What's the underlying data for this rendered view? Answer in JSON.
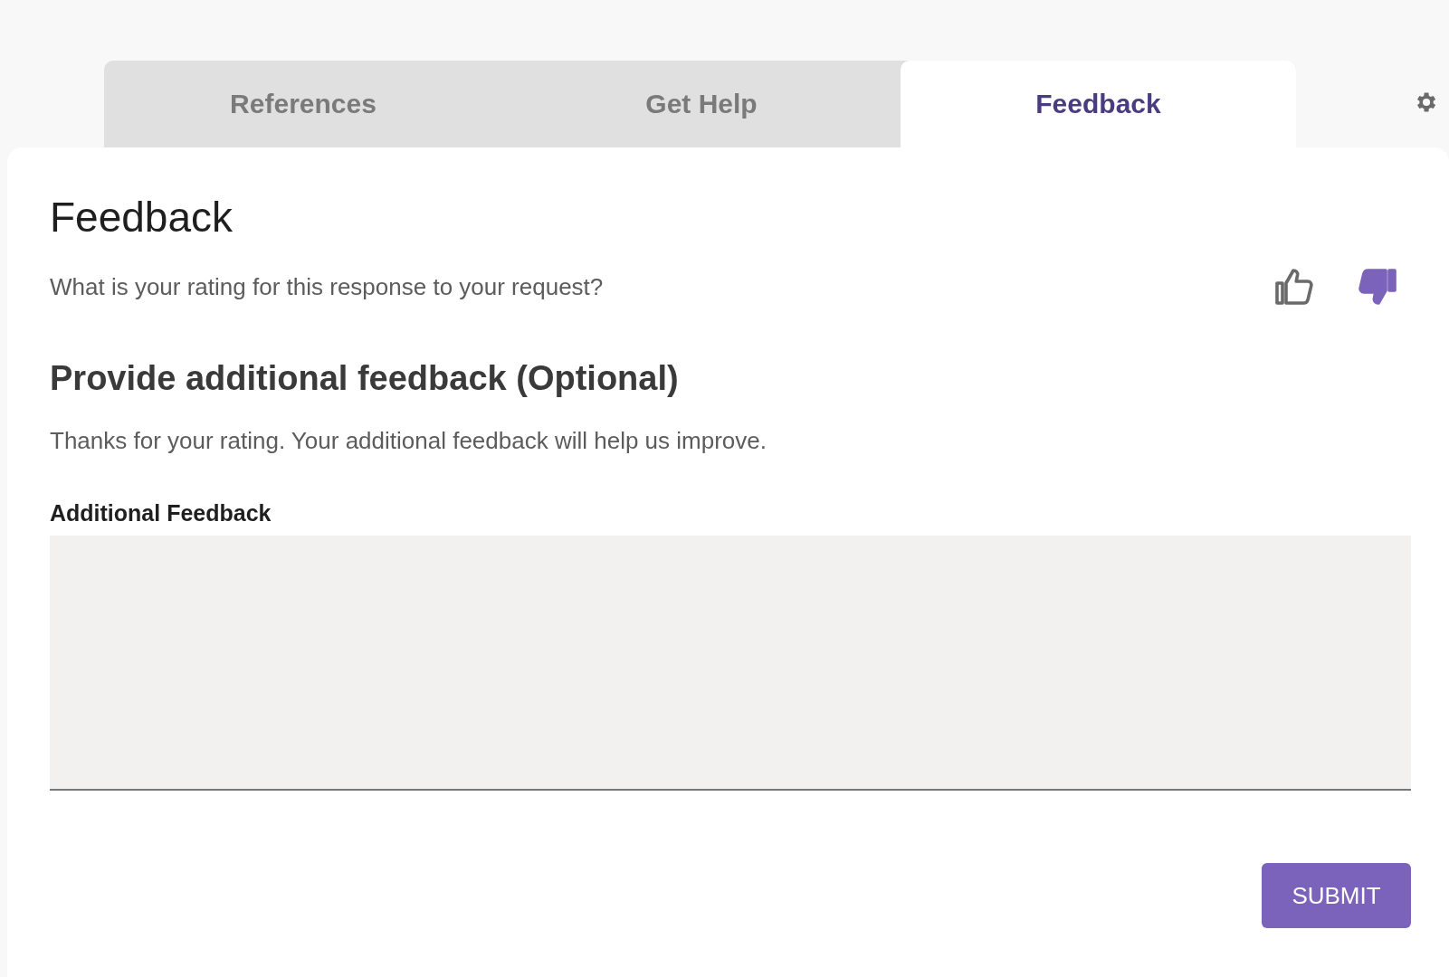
{
  "tabs": [
    {
      "label": "References",
      "selected": false
    },
    {
      "label": "Get Help",
      "selected": false
    },
    {
      "label": "Feedback",
      "selected": true
    }
  ],
  "panel": {
    "title": "Feedback",
    "question": "What is your rating for this response to your request?",
    "rating": [
      {
        "kind": "up",
        "selected": false
      },
      {
        "kind": "down",
        "selected": true
      }
    ],
    "subtitle": "Provide additional feedback (Optional)",
    "description": "Thanks for your rating. Your additional feedback will help us improve.",
    "field_label": "Additional Feedback",
    "submit": "SUBMIT"
  }
}
